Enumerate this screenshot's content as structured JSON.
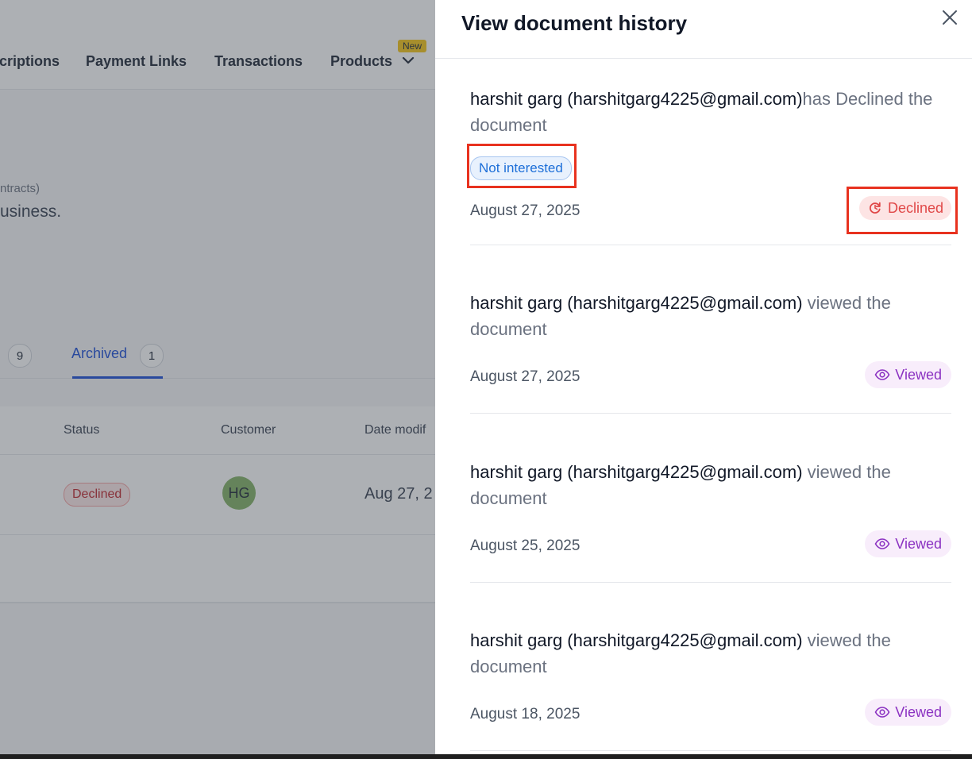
{
  "nav": {
    "items": [
      "criptions",
      "Payment Links",
      "Transactions",
      "Products"
    ],
    "new_badge": "New"
  },
  "intro": {
    "small_text": "ntracts)",
    "big_text": "usiness."
  },
  "tabs": {
    "prev_count": "9",
    "archived_label": "Archived",
    "archived_count": "1"
  },
  "table": {
    "headers": [
      "Status",
      "Customer",
      "Date modif"
    ],
    "row": {
      "status": "Declined",
      "customer_initials": "HG",
      "date": "Aug 27, 2"
    }
  },
  "drawer": {
    "title": "View document history",
    "entries": [
      {
        "actor": "harshit garg (harshitgarg4225@gmail.com)",
        "action": "has Declined the document",
        "reason": "Not interested",
        "date": "August 27, 2025",
        "badge": "Declined"
      },
      {
        "actor": "harshit garg (harshitgarg4225@gmail.com)",
        "action": " viewed the document",
        "date": "August 27, 2025",
        "badge": "Viewed"
      },
      {
        "actor": "harshit garg (harshitgarg4225@gmail.com)",
        "action": " viewed the document",
        "date": "August 25, 2025",
        "badge": "Viewed"
      },
      {
        "actor": "harshit garg (harshitgarg4225@gmail.com)",
        "action": " viewed the document",
        "date": "August 18, 2025",
        "badge": "Viewed"
      }
    ]
  },
  "colors": {
    "accent_blue": "#1d4ed8",
    "declined_red": "#e04848",
    "viewed_purple": "#8b32c2",
    "highlight_red": "#e8321f"
  },
  "icons": {
    "close": "close-icon",
    "declined": "declined-refresh-icon",
    "viewed": "eye-icon",
    "dropdown": "chevron-down-icon"
  }
}
